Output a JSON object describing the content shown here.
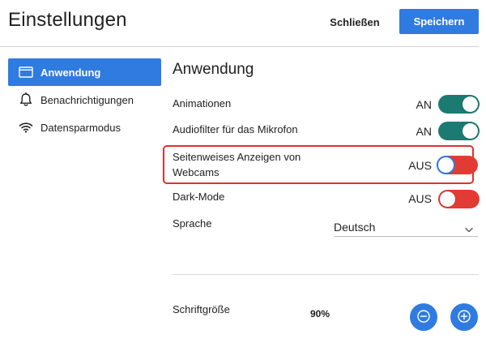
{
  "header": {
    "title": "Einstellungen",
    "close_label": "Schließen",
    "save_label": "Speichern"
  },
  "sidebar": {
    "items": [
      {
        "label": "Anwendung",
        "icon": "window-icon",
        "active": true
      },
      {
        "label": "Benachrichtigungen",
        "icon": "bell-icon",
        "active": false
      },
      {
        "label": "Datensparmodus",
        "icon": "wifi-icon",
        "active": false
      }
    ]
  },
  "main": {
    "section_title": "Anwendung",
    "settings": [
      {
        "label": "Animationen",
        "state_label": "AN",
        "on": true
      },
      {
        "label": "Audiofilter für das Mikrofon",
        "state_label": "AN",
        "on": true
      },
      {
        "label": "Seitenweises Anzeigen von Webcams",
        "state_label": "AUS",
        "on": false,
        "highlighted": true
      },
      {
        "label": "Dark-Mode",
        "state_label": "AUS",
        "on": false
      }
    ],
    "language": {
      "label": "Sprache",
      "value": "Deutsch"
    },
    "font_size": {
      "label": "Schriftgröße",
      "value": "90%"
    }
  },
  "colors": {
    "accent_blue": "#2f7be0",
    "toggle_on": "#1b7a72",
    "toggle_off": "#e23b33",
    "highlight_border": "#e23030"
  }
}
